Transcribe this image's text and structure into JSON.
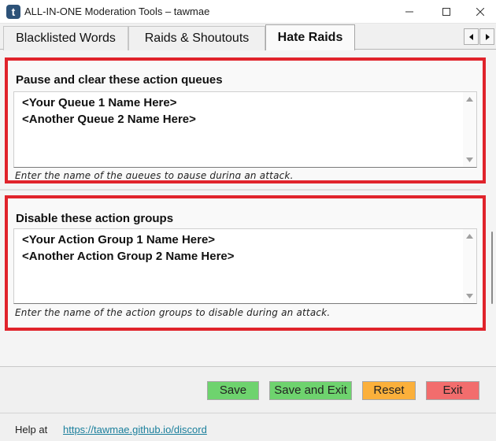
{
  "window": {
    "title": "ALL-IN-ONE Moderation Tools – tawmae",
    "app_icon_letter": "t",
    "app_icon_color": "#2d5278",
    "controls": [
      "minimize-icon",
      "maximize-icon",
      "close-icon"
    ]
  },
  "tabs": [
    {
      "label": "Blacklisted Words",
      "active": false
    },
    {
      "label": "Raids & Shoutouts",
      "active": false
    },
    {
      "label": "Hate Raids",
      "active": true
    }
  ],
  "tab_scroll": {
    "left_icon": "arrow-left-icon",
    "right_icon": "arrow-right-icon"
  },
  "sections": [
    {
      "title": "Pause and clear these action queues",
      "lines": [
        "<Your Queue 1 Name Here>",
        "<Another Queue 2 Name Here>"
      ],
      "hint": "Enter the name of the queues to pause during an attack."
    },
    {
      "title": "Disable these action groups",
      "lines": [
        "<Your Action Group 1 Name Here>",
        "<Another Action Group 2 Name Here>"
      ],
      "hint": "Enter the name of the action groups to disable during an attack."
    }
  ],
  "highlight_color": "#e0232b",
  "buttons": {
    "save": {
      "label": "Save",
      "color": "#6ed36e"
    },
    "save_exit": {
      "label": "Save and Exit",
      "color": "#6ed36e"
    },
    "reset": {
      "label": "Reset",
      "color": "#fbb03b"
    },
    "exit": {
      "label": "Exit",
      "color": "#f26d6d"
    }
  },
  "footer": {
    "help_label": "Help at",
    "help_link": "https://tawmae.github.io/discord"
  }
}
